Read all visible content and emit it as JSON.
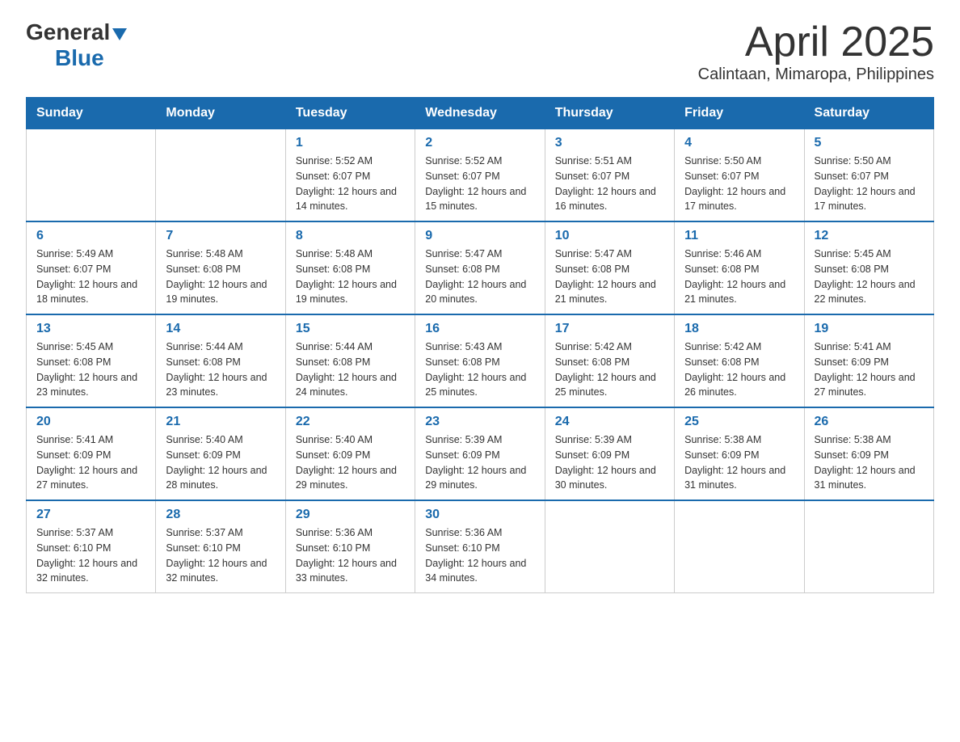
{
  "logo": {
    "general": "General",
    "blue": "Blue"
  },
  "title": "April 2025",
  "location": "Calintaan, Mimaropa, Philippines",
  "weekdays": [
    "Sunday",
    "Monday",
    "Tuesday",
    "Wednesday",
    "Thursday",
    "Friday",
    "Saturday"
  ],
  "weeks": [
    [
      {
        "day": "",
        "sunrise": "",
        "sunset": "",
        "daylight": ""
      },
      {
        "day": "",
        "sunrise": "",
        "sunset": "",
        "daylight": ""
      },
      {
        "day": "1",
        "sunrise": "Sunrise: 5:52 AM",
        "sunset": "Sunset: 6:07 PM",
        "daylight": "Daylight: 12 hours and 14 minutes."
      },
      {
        "day": "2",
        "sunrise": "Sunrise: 5:52 AM",
        "sunset": "Sunset: 6:07 PM",
        "daylight": "Daylight: 12 hours and 15 minutes."
      },
      {
        "day": "3",
        "sunrise": "Sunrise: 5:51 AM",
        "sunset": "Sunset: 6:07 PM",
        "daylight": "Daylight: 12 hours and 16 minutes."
      },
      {
        "day": "4",
        "sunrise": "Sunrise: 5:50 AM",
        "sunset": "Sunset: 6:07 PM",
        "daylight": "Daylight: 12 hours and 17 minutes."
      },
      {
        "day": "5",
        "sunrise": "Sunrise: 5:50 AM",
        "sunset": "Sunset: 6:07 PM",
        "daylight": "Daylight: 12 hours and 17 minutes."
      }
    ],
    [
      {
        "day": "6",
        "sunrise": "Sunrise: 5:49 AM",
        "sunset": "Sunset: 6:07 PM",
        "daylight": "Daylight: 12 hours and 18 minutes."
      },
      {
        "day": "7",
        "sunrise": "Sunrise: 5:48 AM",
        "sunset": "Sunset: 6:08 PM",
        "daylight": "Daylight: 12 hours and 19 minutes."
      },
      {
        "day": "8",
        "sunrise": "Sunrise: 5:48 AM",
        "sunset": "Sunset: 6:08 PM",
        "daylight": "Daylight: 12 hours and 19 minutes."
      },
      {
        "day": "9",
        "sunrise": "Sunrise: 5:47 AM",
        "sunset": "Sunset: 6:08 PM",
        "daylight": "Daylight: 12 hours and 20 minutes."
      },
      {
        "day": "10",
        "sunrise": "Sunrise: 5:47 AM",
        "sunset": "Sunset: 6:08 PM",
        "daylight": "Daylight: 12 hours and 21 minutes."
      },
      {
        "day": "11",
        "sunrise": "Sunrise: 5:46 AM",
        "sunset": "Sunset: 6:08 PM",
        "daylight": "Daylight: 12 hours and 21 minutes."
      },
      {
        "day": "12",
        "sunrise": "Sunrise: 5:45 AM",
        "sunset": "Sunset: 6:08 PM",
        "daylight": "Daylight: 12 hours and 22 minutes."
      }
    ],
    [
      {
        "day": "13",
        "sunrise": "Sunrise: 5:45 AM",
        "sunset": "Sunset: 6:08 PM",
        "daylight": "Daylight: 12 hours and 23 minutes."
      },
      {
        "day": "14",
        "sunrise": "Sunrise: 5:44 AM",
        "sunset": "Sunset: 6:08 PM",
        "daylight": "Daylight: 12 hours and 23 minutes."
      },
      {
        "day": "15",
        "sunrise": "Sunrise: 5:44 AM",
        "sunset": "Sunset: 6:08 PM",
        "daylight": "Daylight: 12 hours and 24 minutes."
      },
      {
        "day": "16",
        "sunrise": "Sunrise: 5:43 AM",
        "sunset": "Sunset: 6:08 PM",
        "daylight": "Daylight: 12 hours and 25 minutes."
      },
      {
        "day": "17",
        "sunrise": "Sunrise: 5:42 AM",
        "sunset": "Sunset: 6:08 PM",
        "daylight": "Daylight: 12 hours and 25 minutes."
      },
      {
        "day": "18",
        "sunrise": "Sunrise: 5:42 AM",
        "sunset": "Sunset: 6:08 PM",
        "daylight": "Daylight: 12 hours and 26 minutes."
      },
      {
        "day": "19",
        "sunrise": "Sunrise: 5:41 AM",
        "sunset": "Sunset: 6:09 PM",
        "daylight": "Daylight: 12 hours and 27 minutes."
      }
    ],
    [
      {
        "day": "20",
        "sunrise": "Sunrise: 5:41 AM",
        "sunset": "Sunset: 6:09 PM",
        "daylight": "Daylight: 12 hours and 27 minutes."
      },
      {
        "day": "21",
        "sunrise": "Sunrise: 5:40 AM",
        "sunset": "Sunset: 6:09 PM",
        "daylight": "Daylight: 12 hours and 28 minutes."
      },
      {
        "day": "22",
        "sunrise": "Sunrise: 5:40 AM",
        "sunset": "Sunset: 6:09 PM",
        "daylight": "Daylight: 12 hours and 29 minutes."
      },
      {
        "day": "23",
        "sunrise": "Sunrise: 5:39 AM",
        "sunset": "Sunset: 6:09 PM",
        "daylight": "Daylight: 12 hours and 29 minutes."
      },
      {
        "day": "24",
        "sunrise": "Sunrise: 5:39 AM",
        "sunset": "Sunset: 6:09 PM",
        "daylight": "Daylight: 12 hours and 30 minutes."
      },
      {
        "day": "25",
        "sunrise": "Sunrise: 5:38 AM",
        "sunset": "Sunset: 6:09 PM",
        "daylight": "Daylight: 12 hours and 31 minutes."
      },
      {
        "day": "26",
        "sunrise": "Sunrise: 5:38 AM",
        "sunset": "Sunset: 6:09 PM",
        "daylight": "Daylight: 12 hours and 31 minutes."
      }
    ],
    [
      {
        "day": "27",
        "sunrise": "Sunrise: 5:37 AM",
        "sunset": "Sunset: 6:10 PM",
        "daylight": "Daylight: 12 hours and 32 minutes."
      },
      {
        "day": "28",
        "sunrise": "Sunrise: 5:37 AM",
        "sunset": "Sunset: 6:10 PM",
        "daylight": "Daylight: 12 hours and 32 minutes."
      },
      {
        "day": "29",
        "sunrise": "Sunrise: 5:36 AM",
        "sunset": "Sunset: 6:10 PM",
        "daylight": "Daylight: 12 hours and 33 minutes."
      },
      {
        "day": "30",
        "sunrise": "Sunrise: 5:36 AM",
        "sunset": "Sunset: 6:10 PM",
        "daylight": "Daylight: 12 hours and 34 minutes."
      },
      {
        "day": "",
        "sunrise": "",
        "sunset": "",
        "daylight": ""
      },
      {
        "day": "",
        "sunrise": "",
        "sunset": "",
        "daylight": ""
      },
      {
        "day": "",
        "sunrise": "",
        "sunset": "",
        "daylight": ""
      }
    ]
  ]
}
